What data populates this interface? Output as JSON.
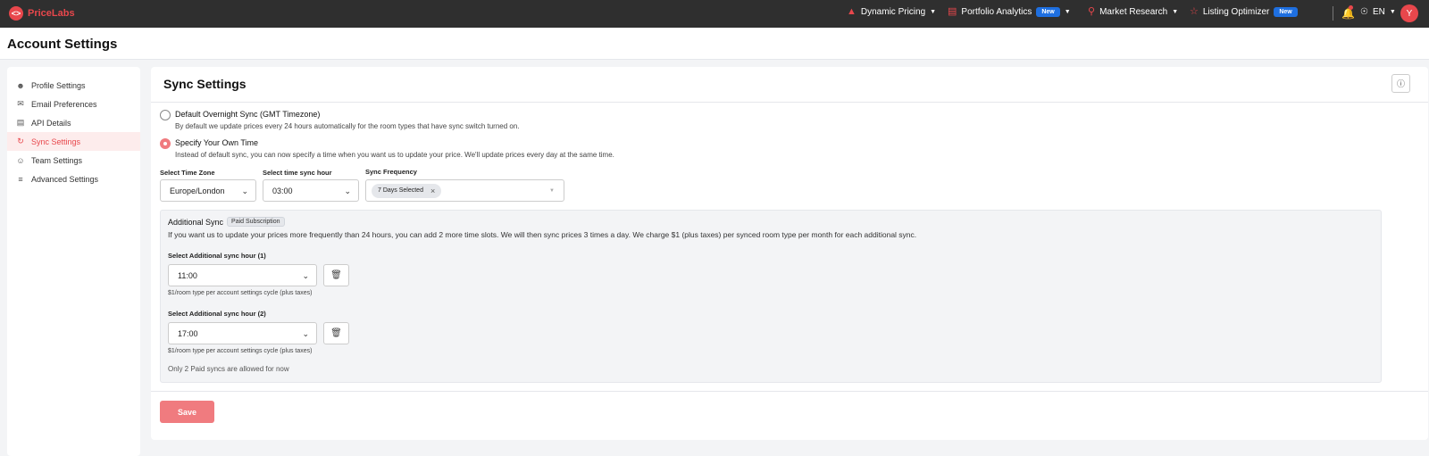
{
  "nav": {
    "logo_text": "PriceLabs",
    "dynamic_pricing": "Dynamic Pricing",
    "portfolio_analytics": "Portfolio Analytics",
    "market_research": "Market Research",
    "listing_optimizer": "Listing Optimizer",
    "new_badge": "New",
    "language": "EN",
    "avatar_initial": "Y"
  },
  "page": {
    "title": "Account Settings"
  },
  "sidebar": {
    "items": [
      {
        "label": "Profile Settings",
        "icon": "user-icon"
      },
      {
        "label": "Email Preferences",
        "icon": "envelope-icon"
      },
      {
        "label": "API Details",
        "icon": "server-icon"
      },
      {
        "label": "Sync Settings",
        "icon": "sync-icon",
        "active": true
      },
      {
        "label": "Team Settings",
        "icon": "team-icon"
      },
      {
        "label": "Advanced Settings",
        "icon": "sliders-icon"
      }
    ]
  },
  "sync": {
    "title": "Sync Settings",
    "option_default": {
      "title": "Default Overnight Sync (GMT Timezone)",
      "desc": "By default we update prices every 24 hours automatically for the room types that have sync switch turned on.",
      "checked": false
    },
    "option_custom": {
      "title": "Specify Your Own Time",
      "desc": "Instead of default sync, you can now specify a time when you want us to update your price. We'll update prices every day at the same time.",
      "checked": true
    },
    "timezone_label": "Select Time Zone",
    "timezone_value": "Europe/London",
    "hour_label": "Select time sync hour",
    "hour_value": "03:00",
    "frequency_label": "Sync Frequency",
    "frequency_chip": "7 Days Selected",
    "additional": {
      "title": "Additional Sync",
      "badge": "Paid Subscription",
      "desc": "If you want us to update your prices more frequently than 24 hours, you can add 2 more time slots. We will then sync prices 3 times a day. We charge $1 (plus taxes) per synced room type per month for each additional sync.",
      "slot1_label": "Select Additional sync hour (1)",
      "slot1_value": "11:00",
      "slot2_label": "Select Additional sync hour (2)",
      "slot2_value": "17:00",
      "cost_hint": "$1/room type per account settings cycle (plus taxes)",
      "note": "Only 2 Paid syncs are allowed for now"
    },
    "save_label": "Save"
  },
  "colors": {
    "brand": "#e8474c",
    "save": "#f07b7f",
    "badge_blue": "#1e6fe0"
  }
}
